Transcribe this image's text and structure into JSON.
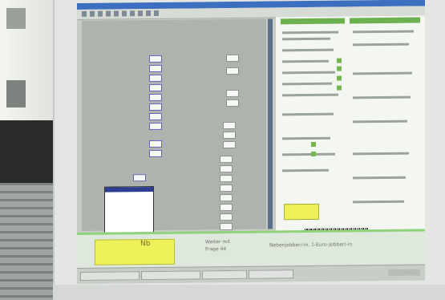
{
  "form_panel": {
    "nb_label": "Nb",
    "field_label_line1": "Weiter mit",
    "field_label_line2": "Frage 44",
    "answer_text": "Nebenjobber/-in, 1-Euro-Jobber/-in"
  },
  "colors": {
    "screen_bg": "#c7cbc7",
    "form_green": "#8fd27a",
    "highlight_yellow": "#eef25a",
    "doc_green": "#6db04f",
    "selection_blue": "#2d3f8e"
  }
}
